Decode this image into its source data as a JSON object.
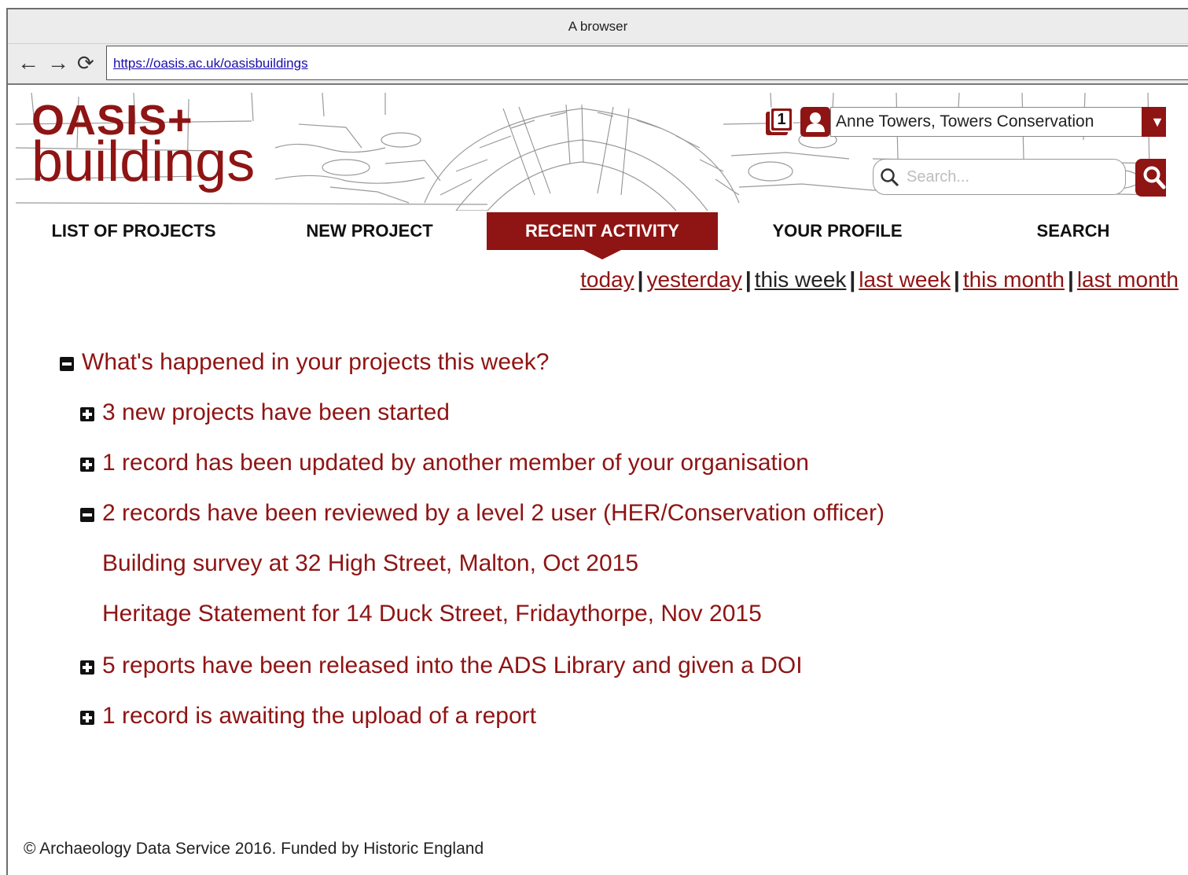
{
  "browser": {
    "title": "A browser",
    "url": "https://oasis.ac.uk/oasisbuildings"
  },
  "header": {
    "logo_top": "OASIS+",
    "logo_bottom": "buildings",
    "notification_count": "1",
    "user_name": "Anne Towers, Towers Conservation",
    "search_placeholder": "Search..."
  },
  "nav": {
    "items": [
      {
        "label": "LIST OF PROJECTS"
      },
      {
        "label": "NEW PROJECT"
      },
      {
        "label": "RECENT ACTIVITY",
        "active": true
      },
      {
        "label": "YOUR PROFILE"
      },
      {
        "label": "SEARCH"
      }
    ]
  },
  "time_filter": {
    "options": [
      "today",
      "yesterday",
      "this week",
      "last week",
      "this month",
      "last month"
    ],
    "selected": "this week",
    "separator": "|"
  },
  "activity": {
    "heading": "What's happened in your projects this week?",
    "items": [
      {
        "label": "3 new projects have been started",
        "expanded": false
      },
      {
        "label": "1 record has been updated by another member of your organisation",
        "expanded": false
      },
      {
        "label": "2 records have been reviewed by a level 2 user (HER/Conservation officer)",
        "expanded": true,
        "children": [
          "Building survey at 32 High Street, Malton, Oct 2015",
          "Heritage Statement for 14 Duck Street, Fridaythorpe, Nov 2015"
        ]
      },
      {
        "label": "5 reports have been released into the ADS Library and given a DOI",
        "expanded": false
      },
      {
        "label": "1 record is awaiting the upload of a report",
        "expanded": false
      }
    ]
  },
  "footer": {
    "text": "© Archaeology Data Service 2016. Funded by Historic England"
  },
  "colors": {
    "brand": "#8f1414",
    "link_selected": "#222222"
  }
}
